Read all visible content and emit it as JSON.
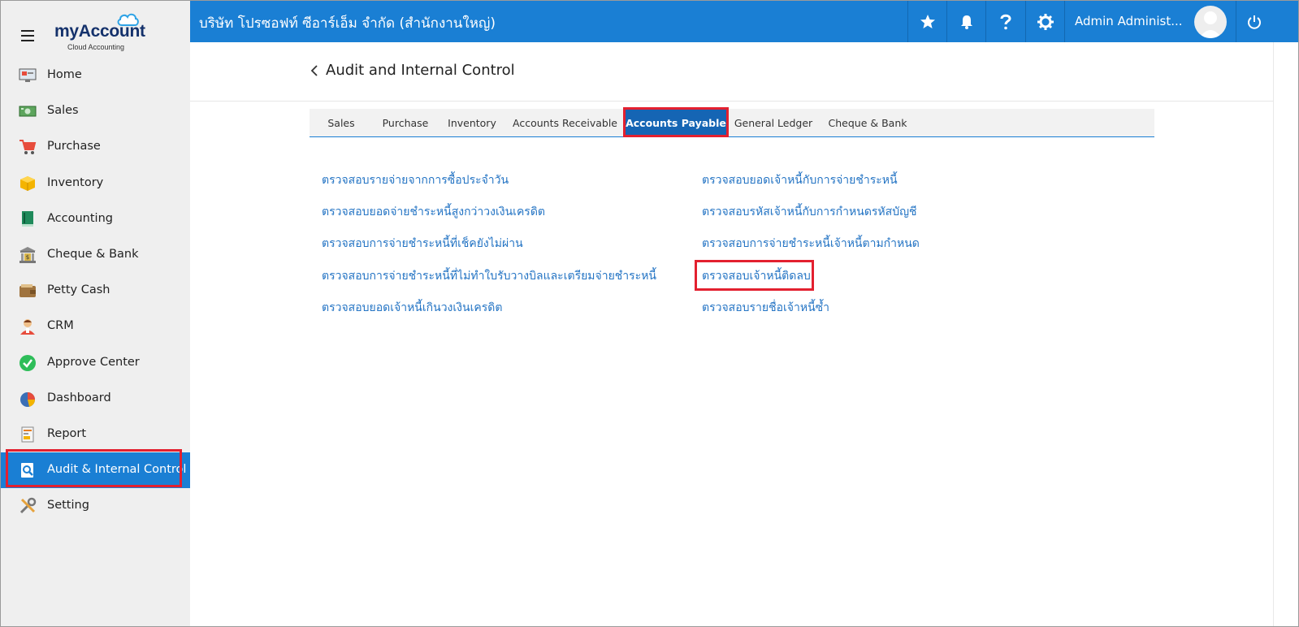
{
  "app": {
    "logo_prefix": "my",
    "logo_main": "Account",
    "logo_sub": "Cloud Accounting"
  },
  "sidebar": {
    "items": [
      {
        "label": "Home",
        "icon": "home-monitor-icon"
      },
      {
        "label": "Sales",
        "icon": "sales-cash-icon"
      },
      {
        "label": "Purchase",
        "icon": "purchase-cart-icon"
      },
      {
        "label": "Inventory",
        "icon": "inventory-box-icon"
      },
      {
        "label": "Accounting",
        "icon": "accounting-book-icon"
      },
      {
        "label": "Cheque & Bank",
        "icon": "bank-icon"
      },
      {
        "label": "Petty Cash",
        "icon": "wallet-icon"
      },
      {
        "label": "CRM",
        "icon": "crm-person-icon"
      },
      {
        "label": "Approve Center",
        "icon": "check-circle-icon"
      },
      {
        "label": "Dashboard",
        "icon": "pie-chart-icon"
      },
      {
        "label": "Report",
        "icon": "report-icon"
      },
      {
        "label": "Audit & Internal Control",
        "icon": "audit-magnifier-icon"
      },
      {
        "label": "Setting",
        "icon": "tools-icon"
      }
    ],
    "active_index": 11
  },
  "topbar": {
    "company": "บริษัท โปรซอฟท์ ซีอาร์เอ็ม จำกัด (สำนักงานใหญ่)",
    "user_name": "Admin Administ..."
  },
  "page": {
    "title": "Audit and Internal Control"
  },
  "tabs": [
    {
      "label": "Sales"
    },
    {
      "label": "Purchase"
    },
    {
      "label": "Inventory"
    },
    {
      "label": "Accounts Receivable"
    },
    {
      "label": "Accounts Payable"
    },
    {
      "label": "General Ledger"
    },
    {
      "label": "Cheque & Bank"
    }
  ],
  "active_tab": "Accounts Payable",
  "links": {
    "left": [
      "ตรวจสอบรายจ่ายจากการซื้อประจำวัน",
      "ตรวจสอบยอดจ่ายชำระหนี้สูงกว่าวงเงินเครดิต",
      "ตรวจสอบการจ่ายชำระหนี้ที่เช็คยังไม่ผ่าน",
      "ตรวจสอบการจ่ายชำระหนี้ที่ไม่ทำใบรับวางบิลและเตรียมจ่ายชำระหนี้",
      "ตรวจสอบยอดเจ้าหนี้เกินวงเงินเครดิต"
    ],
    "right": [
      "ตรวจสอบยอดเจ้าหนี้กับการจ่ายชำระหนี้",
      "ตรวจสอบรหัสเจ้าหนี้กับการกำหนดรหัสบัญชี",
      "ตรวจสอบการจ่ายชำระหนี้เจ้าหนี้ตามกำหนด",
      "ตรวจสอบเจ้าหนี้ติดลบ",
      "ตรวจสอบรายชื่อเจ้าหนี้ซ้ำ"
    ]
  },
  "colors": {
    "primary": "#1a7fd4",
    "active_tab": "#1565b4",
    "highlight": "#e3202f",
    "link": "#2474c4"
  }
}
